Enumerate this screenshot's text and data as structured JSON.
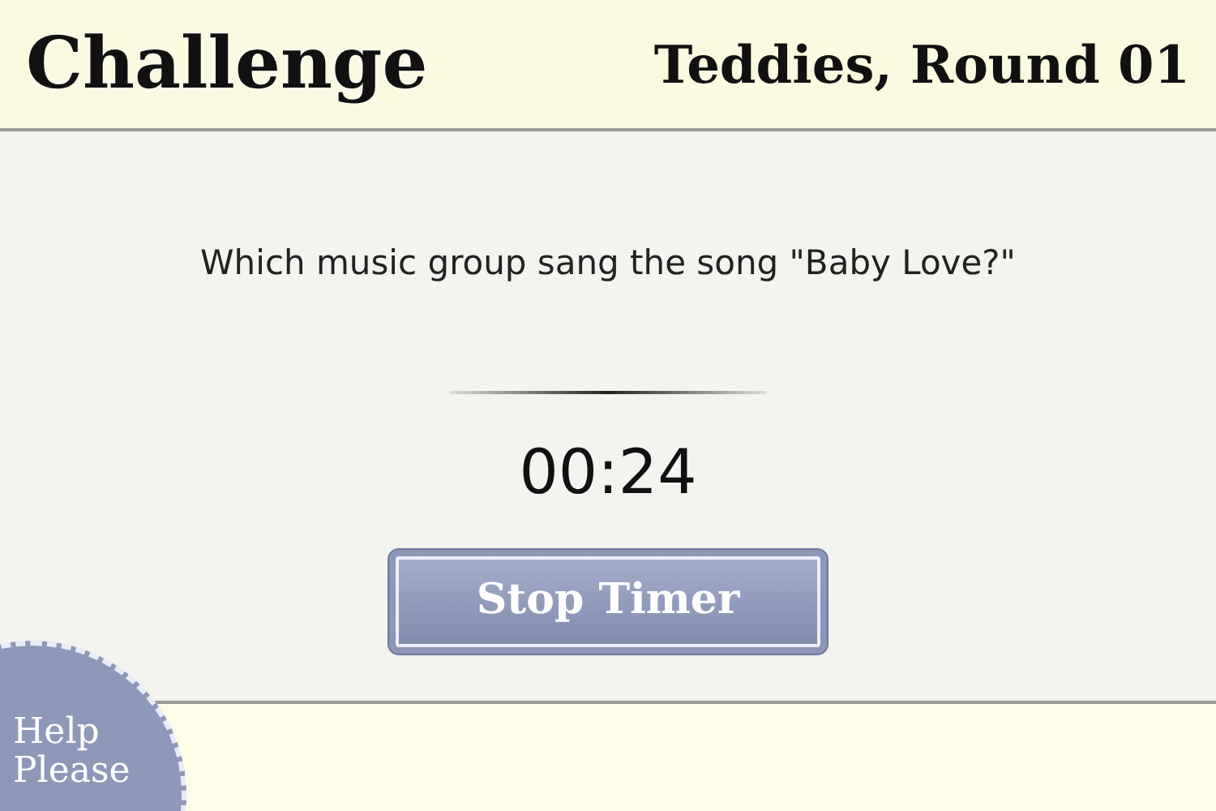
{
  "header": {
    "title": "Challenge",
    "subtitle": "Teddies, Round 01"
  },
  "question": "Which music group sang the song \"Baby Love?\"",
  "timer": "00:24",
  "stop_button": "Stop Timer",
  "help_button": "Help Please"
}
